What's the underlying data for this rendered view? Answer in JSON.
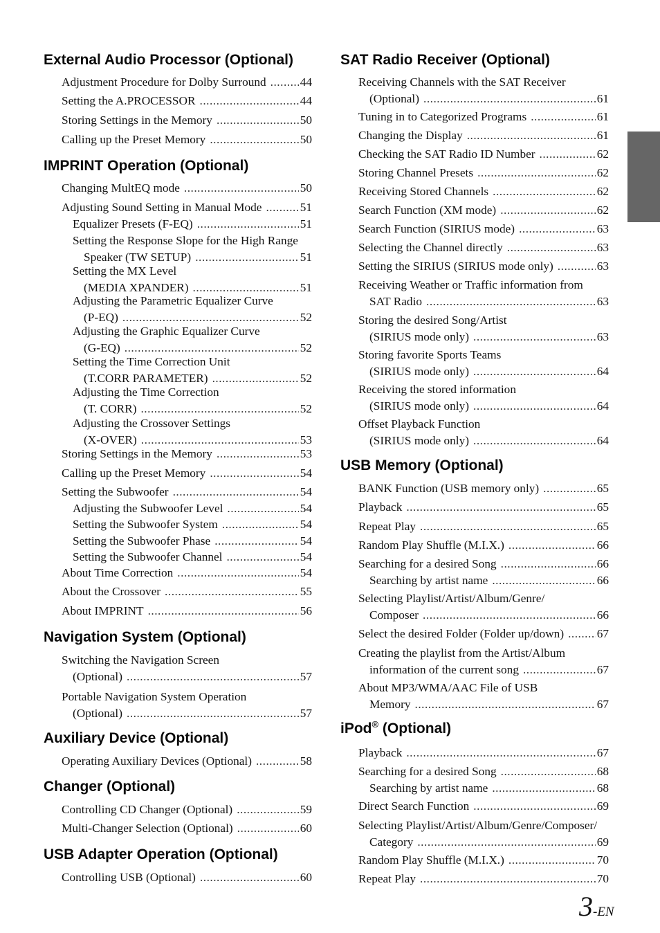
{
  "document": {
    "page_number": "3",
    "page_suffix": "-EN",
    "side_tab_color": "#666666"
  },
  "left_column": [
    {
      "heading": "External Audio Processor (Optional)",
      "entries": [
        {
          "lines": [
            "Adjustment Procedure for Dolby Surround"
          ],
          "page": "44",
          "level": 1
        },
        {
          "lines": [
            "Setting the A.PROCESSOR"
          ],
          "page": "44",
          "level": 1
        },
        {
          "lines": [
            "Storing Settings in the Memory"
          ],
          "page": "50",
          "level": 1
        },
        {
          "lines": [
            "Calling up the Preset Memory"
          ],
          "page": "50",
          "level": 1
        }
      ]
    },
    {
      "heading": "IMPRINT Operation (Optional)",
      "entries": [
        {
          "lines": [
            "Changing MultEQ mode"
          ],
          "page": "50",
          "level": 1
        },
        {
          "lines": [
            "Adjusting Sound Setting in Manual Mode"
          ],
          "page": "51",
          "level": 1
        },
        {
          "lines": [
            "Equalizer Presets (F-EQ)"
          ],
          "page": "51",
          "level": 2
        },
        {
          "lines": [
            "Setting the Response Slope for the High Range",
            "Speaker (TW SETUP)"
          ],
          "page": "51",
          "level": 2
        },
        {
          "lines": [
            "Setting the MX Level",
            "(MEDIA XPANDER)"
          ],
          "page": "51",
          "level": 2
        },
        {
          "lines": [
            "Adjusting the Parametric Equalizer Curve",
            "(P-EQ)"
          ],
          "page": "52",
          "level": 2
        },
        {
          "lines": [
            "Adjusting the Graphic Equalizer Curve",
            "(G-EQ)"
          ],
          "page": "52",
          "level": 2
        },
        {
          "lines": [
            "Setting the Time Correction Unit",
            "(T.CORR PARAMETER)"
          ],
          "page": "52",
          "level": 2
        },
        {
          "lines": [
            "Adjusting the Time Correction",
            "(T. CORR)"
          ],
          "page": "52",
          "level": 2
        },
        {
          "lines": [
            "Adjusting the Crossover Settings",
            "(X-OVER)"
          ],
          "page": "53",
          "level": 2
        },
        {
          "lines": [
            "Storing Settings in the Memory"
          ],
          "page": "53",
          "level": 1
        },
        {
          "lines": [
            "Calling up the Preset Memory"
          ],
          "page": "54",
          "level": 1
        },
        {
          "lines": [
            "Setting the Subwoofer"
          ],
          "page": "54",
          "level": 1
        },
        {
          "lines": [
            "Adjusting the Subwoofer Level"
          ],
          "page": "54",
          "level": 2
        },
        {
          "lines": [
            "Setting the Subwoofer System"
          ],
          "page": "54",
          "level": 2
        },
        {
          "lines": [
            "Setting the Subwoofer Phase"
          ],
          "page": "54",
          "level": 2
        },
        {
          "lines": [
            "Setting the Subwoofer Channel"
          ],
          "page": "54",
          "level": 2
        },
        {
          "lines": [
            "About Time Correction"
          ],
          "page": "54",
          "level": 1
        },
        {
          "lines": [
            "About the Crossover"
          ],
          "page": "55",
          "level": 1
        },
        {
          "lines": [
            "About IMPRINT"
          ],
          "page": "56",
          "level": 1
        }
      ]
    },
    {
      "heading": "Navigation System (Optional)",
      "entries": [
        {
          "lines": [
            "Switching the Navigation Screen",
            "(Optional)"
          ],
          "page": "57",
          "level": 1
        },
        {
          "lines": [
            "Portable Navigation System Operation",
            "(Optional)"
          ],
          "page": "57",
          "level": 1
        }
      ]
    },
    {
      "heading": "Auxiliary Device (Optional)",
      "entries": [
        {
          "lines": [
            "Operating Auxiliary Devices (Optional)"
          ],
          "page": "58",
          "level": 1
        }
      ]
    },
    {
      "heading": "Changer (Optional)",
      "entries": [
        {
          "lines": [
            "Controlling CD Changer (Optional)"
          ],
          "page": "59",
          "level": 1
        },
        {
          "lines": [
            "Multi-Changer Selection (Optional)"
          ],
          "page": "60",
          "level": 1
        }
      ]
    },
    {
      "heading": "USB Adapter Operation (Optional)",
      "entries": [
        {
          "lines": [
            "Controlling USB (Optional)"
          ],
          "page": "60",
          "level": 1
        }
      ]
    }
  ],
  "right_column": [
    {
      "heading": "SAT Radio Receiver (Optional)",
      "entries": [
        {
          "lines": [
            "Receiving Channels with the SAT Receiver",
            "(Optional)"
          ],
          "page": "61",
          "level": 1
        },
        {
          "lines": [
            "Tuning in to Categorized Programs"
          ],
          "page": "61",
          "level": 1
        },
        {
          "lines": [
            "Changing the Display"
          ],
          "page": "61",
          "level": 1
        },
        {
          "lines": [
            "Checking the SAT Radio ID Number"
          ],
          "page": "62",
          "level": 1
        },
        {
          "lines": [
            "Storing Channel Presets"
          ],
          "page": "62",
          "level": 1
        },
        {
          "lines": [
            "Receiving Stored Channels"
          ],
          "page": "62",
          "level": 1
        },
        {
          "lines": [
            "Search Function (XM mode)"
          ],
          "page": "62",
          "level": 1
        },
        {
          "lines": [
            "Search Function (SIRIUS mode)"
          ],
          "page": "63",
          "level": 1
        },
        {
          "lines": [
            "Selecting the Channel directly"
          ],
          "page": "63",
          "level": 1
        },
        {
          "lines": [
            "Setting the SIRIUS (SIRIUS mode only)"
          ],
          "page": "63",
          "level": 1
        },
        {
          "lines": [
            "Receiving Weather or Traffic information from",
            "SAT Radio"
          ],
          "page": "63",
          "level": 1
        },
        {
          "lines": [
            "Storing the desired Song/Artist",
            "(SIRIUS mode only)"
          ],
          "page": "63",
          "level": 1
        },
        {
          "lines": [
            "Storing favorite Sports Teams",
            "(SIRIUS mode only)"
          ],
          "page": "64",
          "level": 1
        },
        {
          "lines": [
            "Receiving the stored information",
            "(SIRIUS mode only)"
          ],
          "page": "64",
          "level": 1
        },
        {
          "lines": [
            "Offset Playback Function",
            "(SIRIUS mode only)"
          ],
          "page": "64",
          "level": 1
        }
      ]
    },
    {
      "heading": "USB Memory (Optional)",
      "entries": [
        {
          "lines": [
            "BANK Function (USB memory only)"
          ],
          "page": "65",
          "level": 1
        },
        {
          "lines": [
            "Playback"
          ],
          "page": "65",
          "level": 1
        },
        {
          "lines": [
            "Repeat Play"
          ],
          "page": "65",
          "level": 1
        },
        {
          "lines": [
            "Random Play Shuffle (M.I.X.)"
          ],
          "page": "66",
          "level": 1
        },
        {
          "lines": [
            "Searching for a desired Song"
          ],
          "page": "66",
          "level": 1
        },
        {
          "lines": [
            "Searching by artist name"
          ],
          "page": "66",
          "level": 2
        },
        {
          "lines": [
            "Selecting Playlist/Artist/Album/Genre/",
            "Composer"
          ],
          "page": "66",
          "level": 1
        },
        {
          "lines": [
            "Select the desired Folder (Folder up/down)"
          ],
          "page": "67",
          "level": 1
        },
        {
          "lines": [
            "Creating the playlist from the Artist/Album",
            "information of the current song"
          ],
          "page": "67",
          "level": 1
        },
        {
          "lines": [
            "About MP3/WMA/AAC File of USB",
            "Memory"
          ],
          "page": "67",
          "level": 1
        }
      ]
    },
    {
      "heading": "iPod",
      "heading_sup": "®",
      "heading_rest": " (Optional)",
      "entries": [
        {
          "lines": [
            "Playback"
          ],
          "page": "67",
          "level": 1
        },
        {
          "lines": [
            "Searching for a desired Song"
          ],
          "page": "68",
          "level": 1
        },
        {
          "lines": [
            "Searching by artist name"
          ],
          "page": "68",
          "level": 2
        },
        {
          "lines": [
            "Direct Search Function"
          ],
          "page": "69",
          "level": 1
        },
        {
          "lines": [
            "Selecting Playlist/Artist/Album/Genre/Composer/",
            "Category"
          ],
          "page": "69",
          "level": 1
        },
        {
          "lines": [
            "Random Play Shuffle (M.I.X.)"
          ],
          "page": "70",
          "level": 1
        },
        {
          "lines": [
            "Repeat Play"
          ],
          "page": "70",
          "level": 1
        }
      ]
    }
  ]
}
